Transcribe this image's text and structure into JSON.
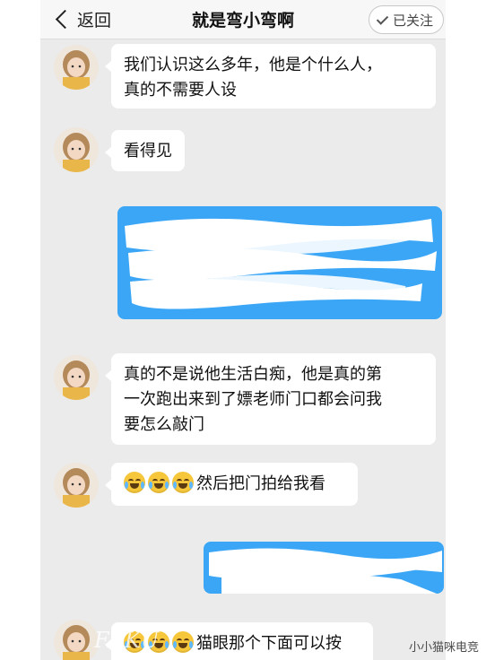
{
  "header": {
    "back_label": "返回",
    "title": "就是弯小弯啊",
    "follow_label": "已关注"
  },
  "messages": [
    {
      "side": "received",
      "text": "我们认识这么多年，他是个什么人，\n真的不需要人设"
    },
    {
      "side": "received",
      "text": "看得见"
    },
    {
      "side": "sent",
      "text": ""
    },
    {
      "side": "received",
      "text": "真的不是说他生活白痴，他是真的第\n一次跑出来到了嫖老师门口都会问我\n要怎么敲门"
    },
    {
      "side": "received",
      "emoji_count": 3,
      "emoji_icon": "crying-laughing-face-icon",
      "text": "然后把门拍给我看"
    },
    {
      "side": "sent",
      "text": ""
    },
    {
      "side": "received",
      "emoji_count": 3,
      "emoji_icon": "crying-laughing-face-icon",
      "text": "猫眼那个下面可以按"
    }
  ],
  "watermark": "小小猫咪电竞",
  "overlay_mark": "FAKU",
  "colors": {
    "sent_bubble": "#3ba6f6",
    "received_bubble": "#ffffff",
    "chat_background": "#ebebeb"
  }
}
